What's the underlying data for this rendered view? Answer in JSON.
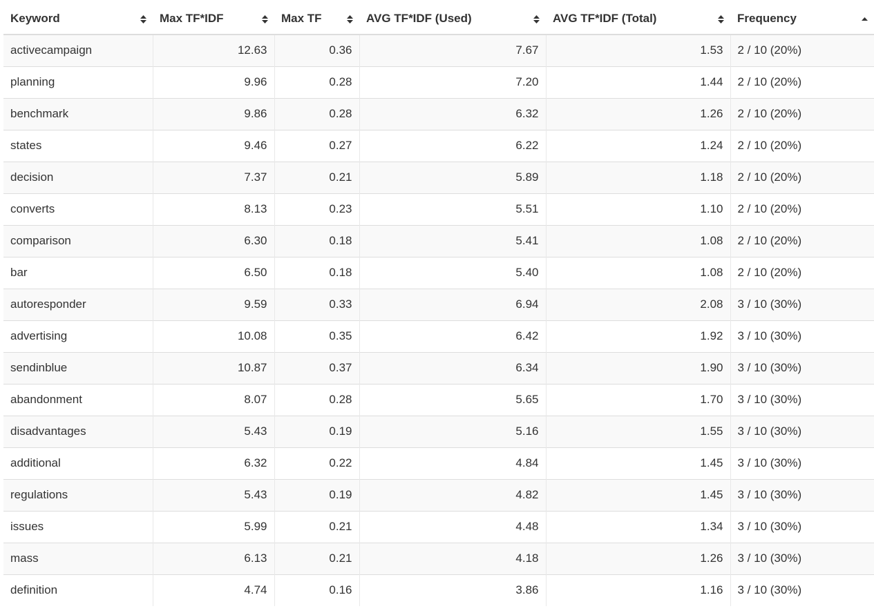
{
  "table": {
    "columns": [
      {
        "label": "Keyword",
        "sort": "none"
      },
      {
        "label": "Max TF*IDF",
        "sort": "none"
      },
      {
        "label": "Max TF",
        "sort": "none"
      },
      {
        "label": "AVG TF*IDF (Used)",
        "sort": "none"
      },
      {
        "label": "AVG TF*IDF (Total)",
        "sort": "none"
      },
      {
        "label": "Frequency",
        "sort": "ascending"
      }
    ],
    "rows": [
      [
        "activecampaign",
        "12.63",
        "0.36",
        "7.67",
        "1.53",
        "2 / 10 (20%)"
      ],
      [
        "planning",
        "9.96",
        "0.28",
        "7.20",
        "1.44",
        "2 / 10 (20%)"
      ],
      [
        "benchmark",
        "9.86",
        "0.28",
        "6.32",
        "1.26",
        "2 / 10 (20%)"
      ],
      [
        "states",
        "9.46",
        "0.27",
        "6.22",
        "1.24",
        "2 / 10 (20%)"
      ],
      [
        "decision",
        "7.37",
        "0.21",
        "5.89",
        "1.18",
        "2 / 10 (20%)"
      ],
      [
        "converts",
        "8.13",
        "0.23",
        "5.51",
        "1.10",
        "2 / 10 (20%)"
      ],
      [
        "comparison",
        "6.30",
        "0.18",
        "5.41",
        "1.08",
        "2 / 10 (20%)"
      ],
      [
        "bar",
        "6.50",
        "0.18",
        "5.40",
        "1.08",
        "2 / 10 (20%)"
      ],
      [
        "autoresponder",
        "9.59",
        "0.33",
        "6.94",
        "2.08",
        "3 / 10 (30%)"
      ],
      [
        "advertising",
        "10.08",
        "0.35",
        "6.42",
        "1.92",
        "3 / 10 (30%)"
      ],
      [
        "sendinblue",
        "10.87",
        "0.37",
        "6.34",
        "1.90",
        "3 / 10 (30%)"
      ],
      [
        "abandonment",
        "8.07",
        "0.28",
        "5.65",
        "1.70",
        "3 / 10 (30%)"
      ],
      [
        "disadvantages",
        "5.43",
        "0.19",
        "5.16",
        "1.55",
        "3 / 10 (30%)"
      ],
      [
        "additional",
        "6.32",
        "0.22",
        "4.84",
        "1.45",
        "3 / 10 (30%)"
      ],
      [
        "regulations",
        "5.43",
        "0.19",
        "4.82",
        "1.45",
        "3 / 10 (30%)"
      ],
      [
        "issues",
        "5.99",
        "0.21",
        "4.48",
        "1.34",
        "3 / 10 (30%)"
      ],
      [
        "mass",
        "6.13",
        "0.21",
        "4.18",
        "1.26",
        "3 / 10 (30%)"
      ],
      [
        "definition",
        "4.74",
        "0.16",
        "3.86",
        "1.16",
        "3 / 10 (30%)"
      ]
    ]
  },
  "colors": {
    "text": "#333333",
    "stripe": "#f9f9f9",
    "border": "#dddddd",
    "sort_icon": "#333333"
  },
  "icons": {
    "unsorted": "sort-both-icon",
    "ascending": "sort-up-icon"
  }
}
